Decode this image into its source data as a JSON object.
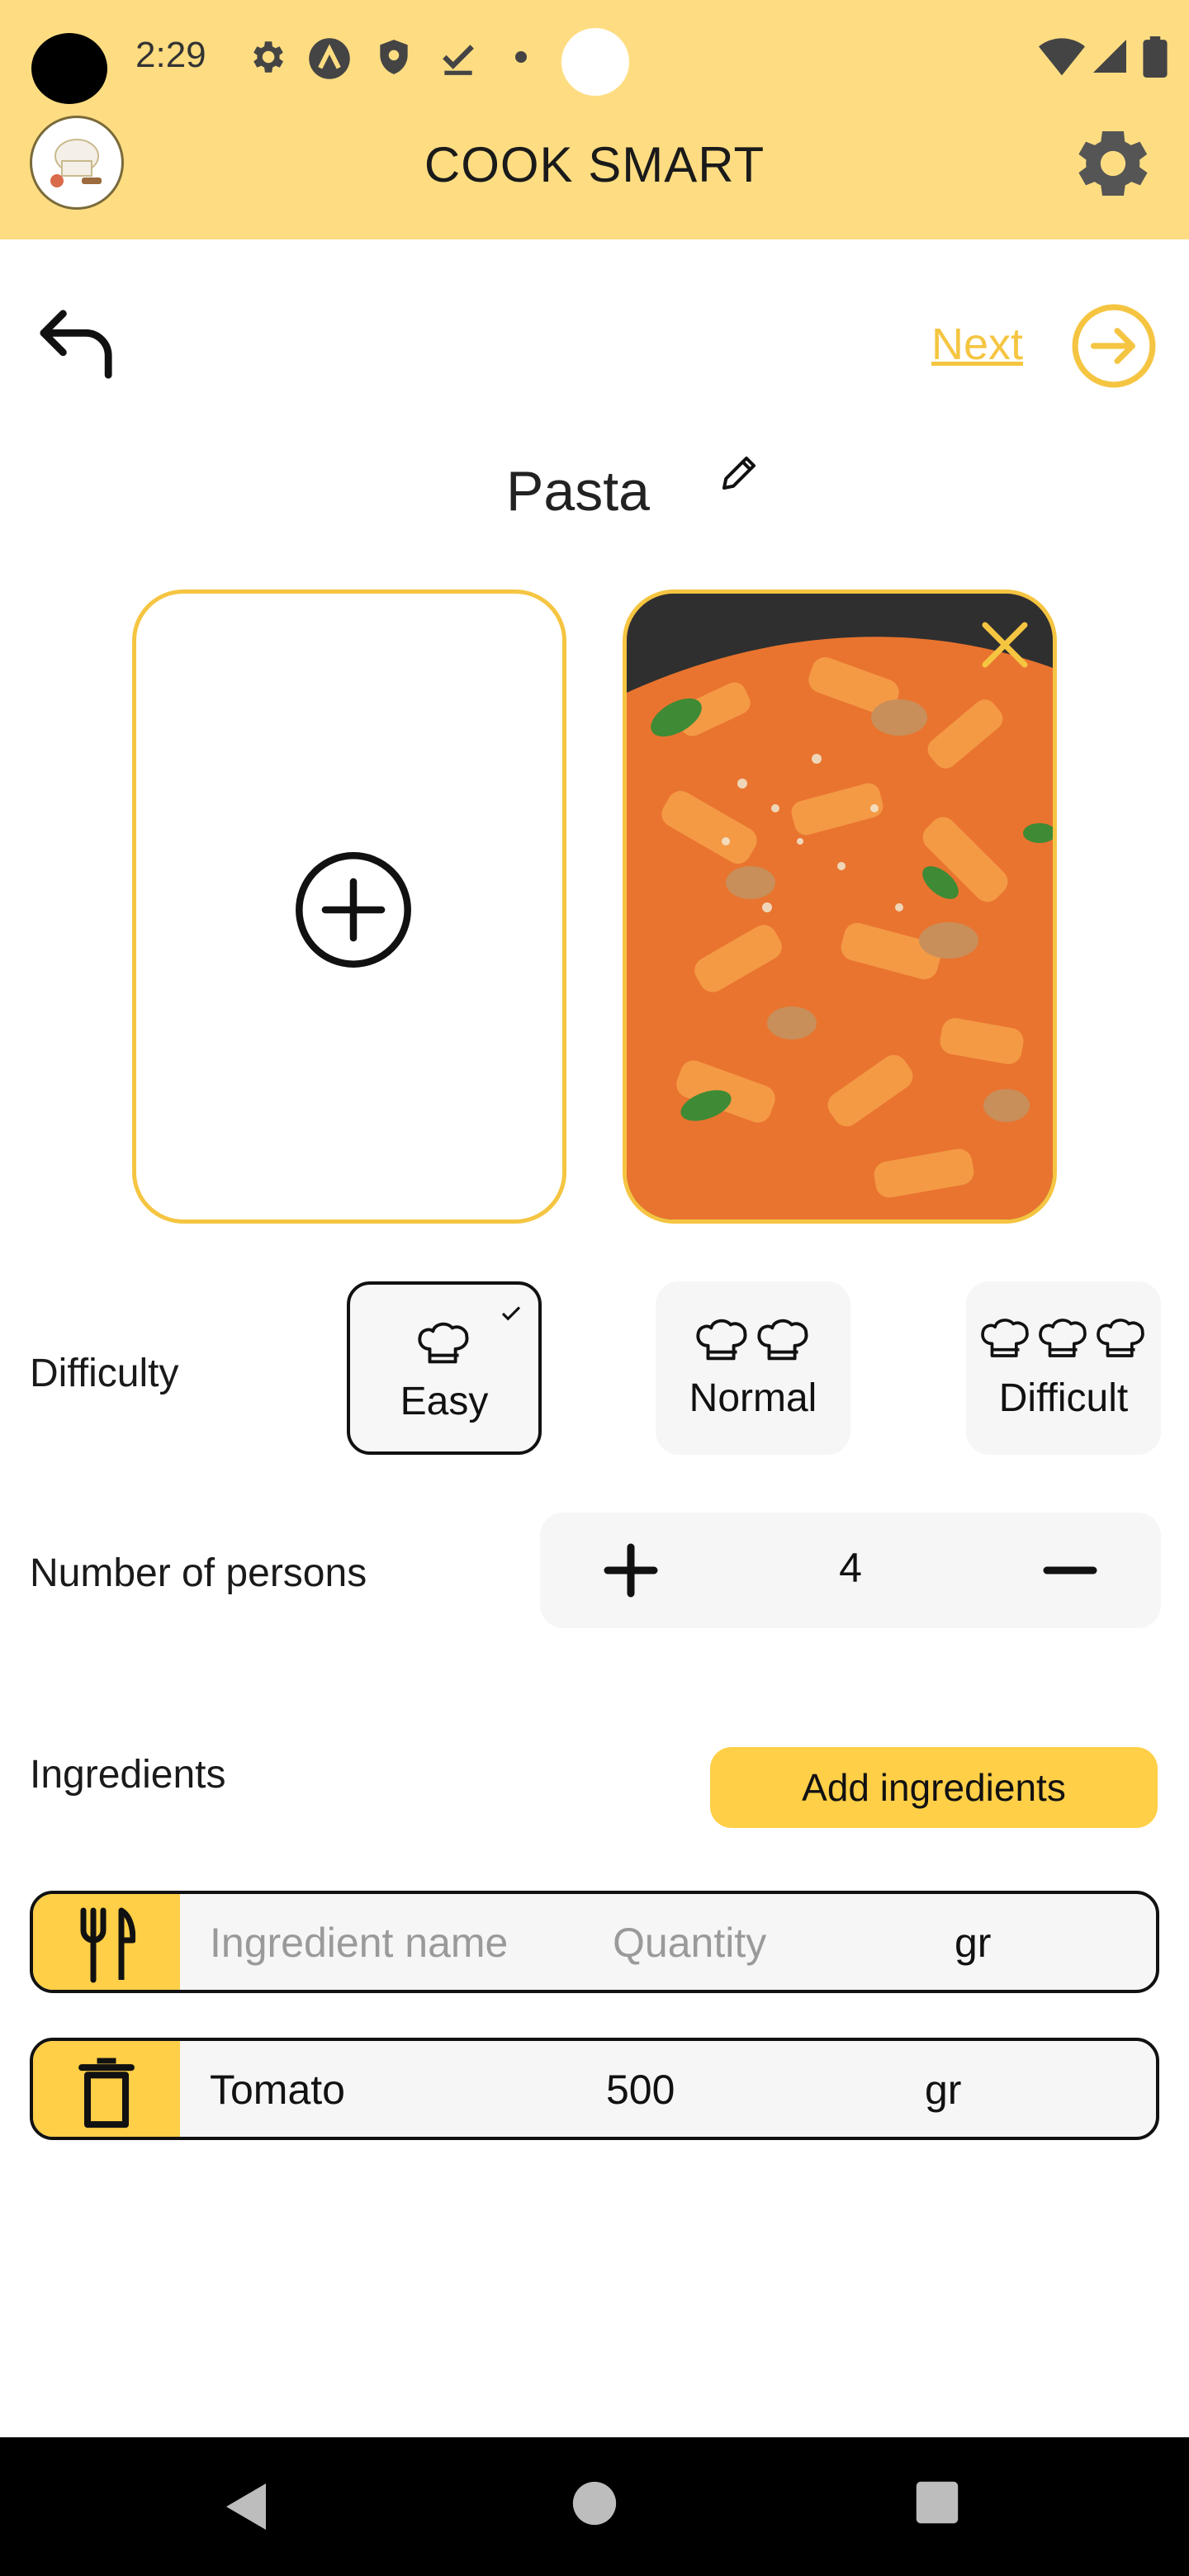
{
  "status_bar": {
    "time": "2:29"
  },
  "app_bar": {
    "title": "COOK SMART"
  },
  "nav": {
    "next_label": "Next"
  },
  "recipe": {
    "name": "Pasta"
  },
  "difficulty": {
    "label": "Difficulty",
    "options": [
      {
        "label": "Easy",
        "hats": 1,
        "selected": true
      },
      {
        "label": "Normal",
        "hats": 2,
        "selected": false
      },
      {
        "label": "Difficult",
        "hats": 3,
        "selected": false
      }
    ]
  },
  "persons": {
    "label": "Number of persons",
    "value": "4"
  },
  "ingredients": {
    "label": "Ingredients",
    "add_button": "Add ingredients",
    "new_row": {
      "name_placeholder": "Ingredient name",
      "quantity_placeholder": "Quantity",
      "unit": "gr"
    },
    "items": [
      {
        "name": "Tomato",
        "quantity": "500",
        "unit": "gr"
      }
    ]
  },
  "colors": {
    "accent": "#FEDD82",
    "button": "#FFCF47",
    "border": "#F5C542"
  },
  "icons": [
    "settings-icon",
    "back-arrow-icon",
    "next-arrow-icon",
    "edit-pencil-icon",
    "add-photo-icon",
    "close-icon",
    "chef-hat-icon",
    "plus-icon",
    "minus-icon",
    "fork-knife-icon",
    "trash-icon"
  ]
}
